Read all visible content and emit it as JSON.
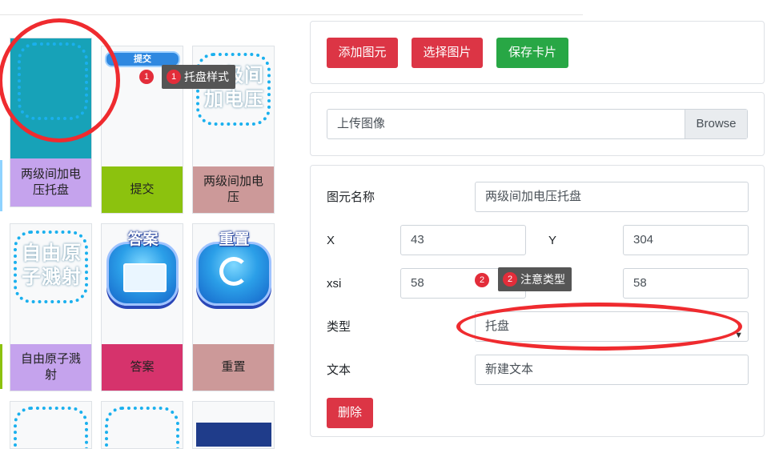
{
  "cards": [
    {
      "label": "两级间加电压托盘",
      "label_color": "#c5a3ed"
    },
    {
      "label": "提交",
      "label_color": "#8cc20e",
      "pill": "提交"
    },
    {
      "label": "两级间加电压",
      "label_color": "#cc9999",
      "overlay": "两级间加电压"
    },
    {
      "label": "自由原子溅射",
      "label_color": "#c5a3ed",
      "overlay": "自由原子溅射"
    },
    {
      "label": "答案",
      "label_color": "#d6336c",
      "cap": "答案"
    },
    {
      "label": "重置",
      "label_color": "#cc9999",
      "cap": "重置"
    }
  ],
  "tooltips": [
    {
      "num": "1",
      "text": "托盘样式"
    },
    {
      "num": "2",
      "text": "注意类型"
    }
  ],
  "toolbar": {
    "add_label": "添加图元",
    "select_label": "选择图片",
    "save_label": "保存卡片"
  },
  "upload": {
    "filename": "上传图像",
    "browse_label": "Browse"
  },
  "form": {
    "name_label": "图元名称",
    "name_value": "两级间加电压托盘",
    "x_label": "X",
    "x_value": "43",
    "y_label": "Y",
    "y_value": "304",
    "xsi_label": "xsi",
    "xsi_value": "58",
    "ysi_value": "58",
    "type_label": "类型",
    "type_value": "托盘",
    "text_label": "文本",
    "text_value": "新建文本",
    "delete_label": "删除"
  },
  "colors": {
    "danger": "#dc3545",
    "success": "#28a745",
    "annotation": "#ef2b2f",
    "dash": "#1ab0ee"
  }
}
